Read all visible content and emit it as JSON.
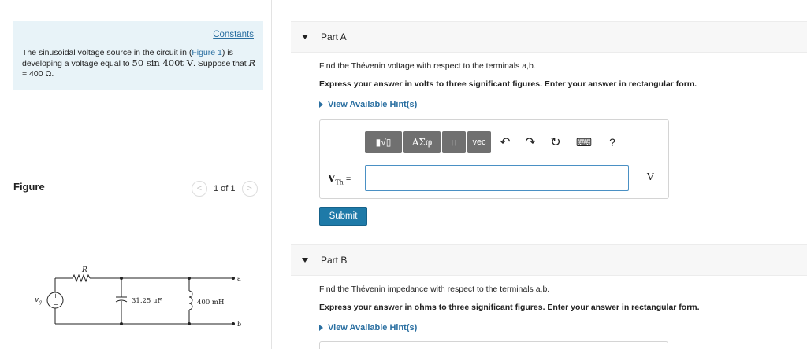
{
  "left": {
    "constants_link": "Constants",
    "problem": {
      "text1": "The sinusoidal voltage source in the circuit in (",
      "figure_link": "Figure 1",
      "text2": ") is developing a voltage equal to ",
      "voltage": "50 sin 400t V",
      "text3": ". Suppose that ",
      "r_symbol": "R",
      "r_value": " = 400 Ω."
    },
    "figure_label": "Figure",
    "pager": "1 of 1"
  },
  "circuit": {
    "resistor_label": "R",
    "source_label": "v",
    "source_sub": "g",
    "plus": "+",
    "minus": "−",
    "capacitor_label": "31.25 μF",
    "inductor_label": "400 mH",
    "terminal_a": "a",
    "terminal_b": "b"
  },
  "partA": {
    "title": "Part A",
    "question": "Find the Thévenin voltage with respect to the terminals a,b.",
    "instruction": "Express your answer in volts to three significant figures. Enter your answer in rectangular form.",
    "hint": "View Available Hint(s)",
    "toolbar": {
      "templates": "▮√▯",
      "greek": "ΑΣφ",
      "abs": "| |",
      "vec": "vec"
    },
    "variable": "V",
    "variable_sub": "Th",
    "equals": " =",
    "input_value": "",
    "unit": "V",
    "submit": "Submit"
  },
  "partB": {
    "title": "Part B",
    "question": "Find the Thévenin impedance with respect to the terminals a,b.",
    "instruction": "Express your answer in ohms to three significant figures. Enter your answer in rectangular form.",
    "hint": "View Available Hint(s)"
  }
}
